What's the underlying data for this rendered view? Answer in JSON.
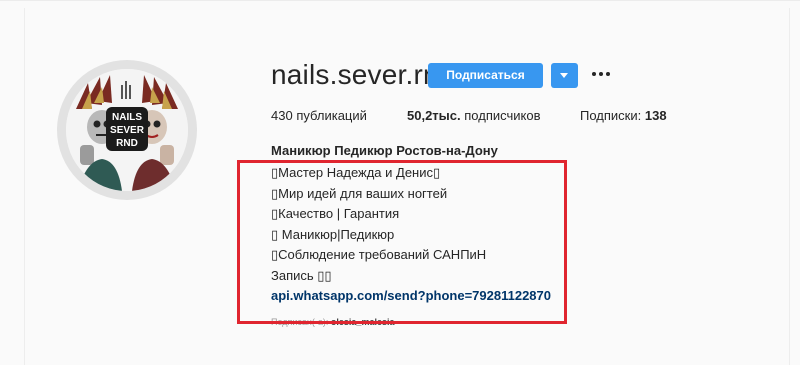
{
  "profile": {
    "username": "nails.sever.rnd",
    "avatar_text": [
      "NAILS",
      "SEVER",
      "RND"
    ]
  },
  "actions": {
    "follow_label": "Подписаться",
    "dropdown_icon": "chevron-down-icon",
    "more_icon": "more-options-icon"
  },
  "stats": {
    "posts_count": "430",
    "posts_label": "публикаций",
    "followers_count": "50,2тыс.",
    "followers_label": "подписчиков",
    "following_label": "Подписки:",
    "following_count": "138"
  },
  "bio": {
    "name": "Маникюр Педикюр Ростов-на-Дону",
    "lines": [
      "▯Мастер Надежда и Денис▯",
      "▯Мир идей для ваших ногтей",
      "▯Качество | Гарантия",
      "▯ Маникюр|Педикюр",
      "▯Соблюдение требований САНПиН",
      "Запись ▯▯"
    ],
    "link": "api.whatsapp.com/send?phone=79281122870",
    "followed_by_label": "Подписан(-а):",
    "followed_by_user": "olesia_malesia"
  },
  "colors": {
    "accent": "#3897f0",
    "link": "#003569",
    "highlight": "#e0252f"
  }
}
